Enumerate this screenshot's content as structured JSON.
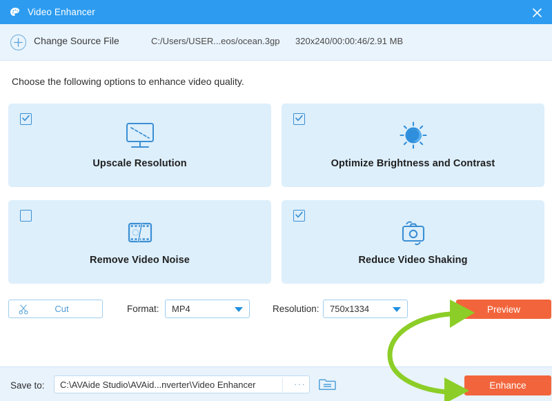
{
  "window": {
    "title": "Video Enhancer",
    "logo_icon": "palette-icon",
    "close_icon": "close-icon",
    "titlebar_color": "#2d9cf0"
  },
  "source_bar": {
    "add_icon": "plus-circle-icon",
    "change_source_label": "Change Source File",
    "path": "C:/Users/USER...eos/ocean.3gp",
    "meta": "320x240/00:00:46/2.91 MB"
  },
  "instruction": "Choose the following options to enhance video quality.",
  "options": [
    {
      "label": "Upscale Resolution",
      "checked": true,
      "icon": "monitor-upscale-icon"
    },
    {
      "label": "Optimize Brightness and Contrast",
      "checked": true,
      "icon": "sun-brightness-icon"
    },
    {
      "label": "Remove Video Noise",
      "checked": false,
      "icon": "film-strip-icon"
    },
    {
      "label": "Reduce Video Shaking",
      "checked": true,
      "icon": "camera-stabilize-icon"
    }
  ],
  "controls": {
    "cut_label": "Cut",
    "cut_icon": "scissors-icon",
    "format_label": "Format:",
    "format_value": "MP4",
    "resolution_label": "Resolution:",
    "resolution_value": "750x1334",
    "dropdown_icon": "chevron-down-icon",
    "preview_label": "Preview"
  },
  "save_bar": {
    "save_to_label": "Save to:",
    "path_value": "C:\\AVAide Studio\\AVAid...nverter\\Video Enhancer",
    "browse_dots": "···",
    "folder_icon": "open-folder-icon",
    "enhance_label": "Enhance"
  },
  "annotation": {
    "type": "curved-double-arrow",
    "color": "#8cce27",
    "points_to": [
      "Preview",
      "Enhance"
    ]
  },
  "colors": {
    "accent_blue": "#2d9cf0",
    "card_bg": "#ddeffb",
    "primary_orange": "#f2653c",
    "annotation_green": "#8cce27"
  }
}
